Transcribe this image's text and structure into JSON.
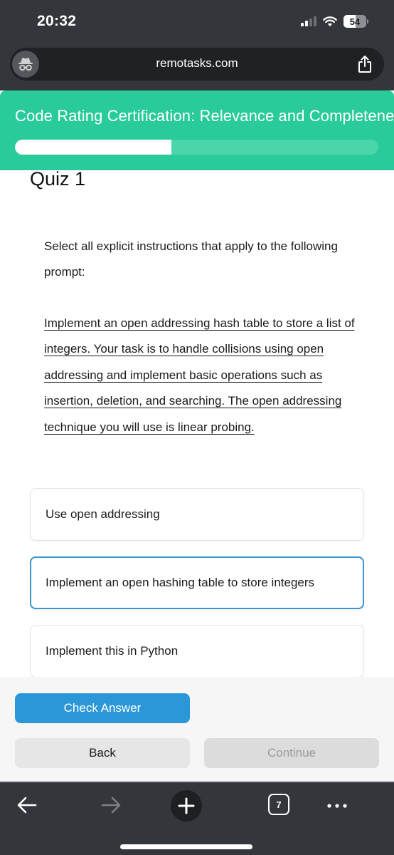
{
  "status_bar": {
    "time": "20:32",
    "battery_percent": "54",
    "battery_level": 0.54,
    "signal_bars_active": 2,
    "signal_bars_total": 4
  },
  "browser": {
    "url": "remotasks.com",
    "tab_count": "7"
  },
  "header": {
    "course_title": "Code Rating Certification: Relevance and Completeness",
    "progress_fraction": 0.43,
    "accent_color": "#2acb9a"
  },
  "quiz": {
    "title": "Quiz 1",
    "instruction": "Select all explicit instructions that apply to the following prompt:",
    "prompt": "Implement an open addressing hash table to store a list of integers. Your task is to handle collisions using open addressing and implement basic operations such as insertion, deletion, and searching. The open addressing technique you will use is linear probing.",
    "options": [
      {
        "label": "Use open addressing",
        "selected": false
      },
      {
        "label": "Implement an open hashing table to store integers",
        "selected": true
      },
      {
        "label": "Implement this in Python",
        "selected": false
      }
    ]
  },
  "actions": {
    "check_answer": "Check Answer",
    "back": "Back",
    "continue": "Continue",
    "primary_color": "#2b96d8"
  },
  "icons": {
    "incognito": "incognito-icon",
    "share": "share-icon",
    "nav_back": "arrow-left-icon",
    "nav_forward": "arrow-right-icon",
    "new_tab": "plus-icon",
    "tabs": "tabs-icon",
    "more": "more-dots-icon"
  }
}
